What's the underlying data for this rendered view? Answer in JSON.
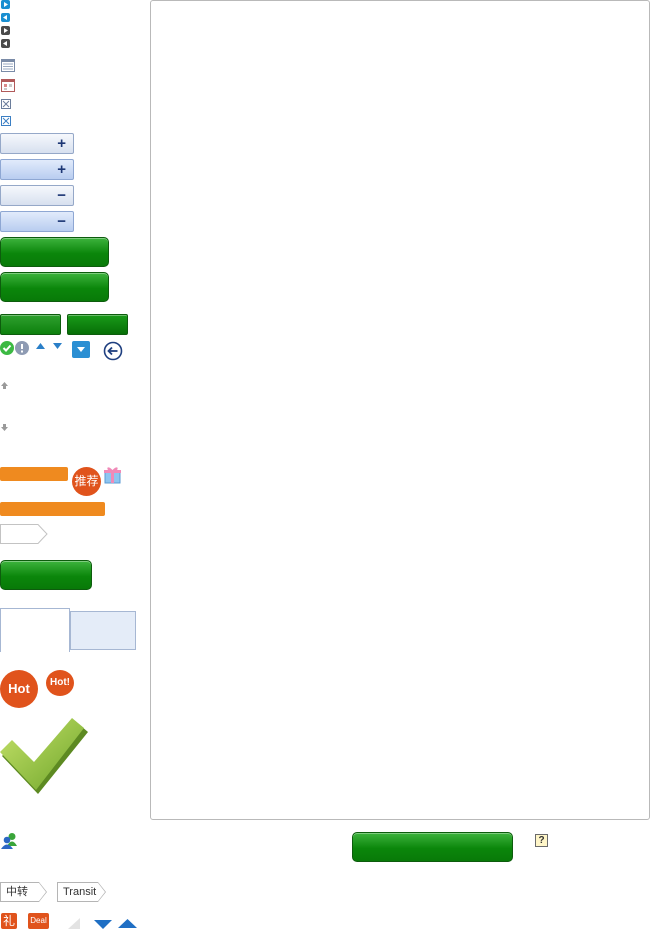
{
  "icons": {
    "nav_right_blue": "play-right-icon",
    "nav_left_blue": "play-left-icon",
    "nav_right_gray": "play-right-icon",
    "nav_left_gray": "play-left-icon"
  },
  "badges": {
    "recommend": "推荐",
    "hot_large": "Hot",
    "hot_small": "Hot!",
    "gift_char": "礼",
    "deal": "Deal",
    "help": "?"
  },
  "breadcrumbs": {
    "zhongzhuan": "中转",
    "transit": "Transit"
  },
  "colors": {
    "green": "#0b860b",
    "orange": "#ef8a1f",
    "blue_accent": "#1a8fd1",
    "hot_red": "#e0531c"
  }
}
